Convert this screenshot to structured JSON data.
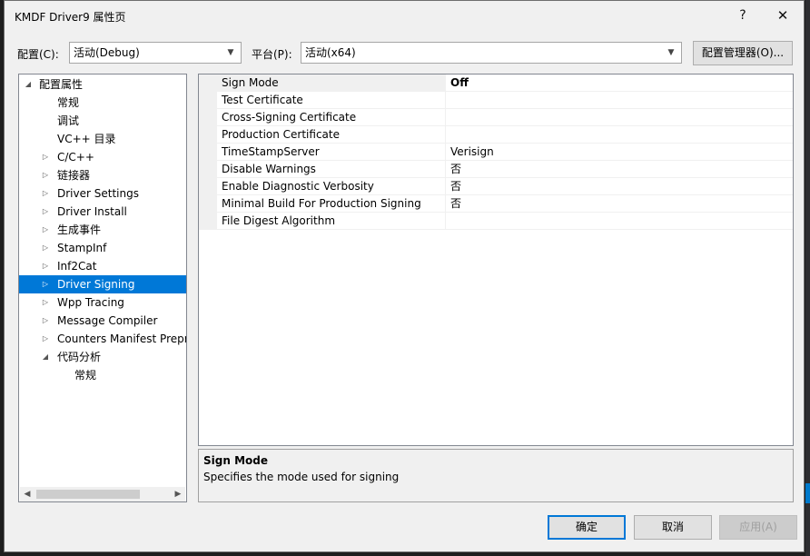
{
  "window": {
    "title": "KMDF Driver9 属性页",
    "help_glyph": "?",
    "close_glyph": "✕"
  },
  "toolbar": {
    "config_label": "配置(C):",
    "config_value": "活动(Debug)",
    "platform_label": "平台(P):",
    "platform_value": "活动(x64)",
    "config_manager_label": "配置管理器(O)..."
  },
  "tree": {
    "items": [
      {
        "label": "配置属性",
        "toggle": "◢",
        "level": 0
      },
      {
        "label": "常规",
        "toggle": "",
        "level": 1
      },
      {
        "label": "调试",
        "toggle": "",
        "level": 1
      },
      {
        "label": "VC++ 目录",
        "toggle": "",
        "level": 1
      },
      {
        "label": "C/C++",
        "toggle": "▷",
        "level": 1
      },
      {
        "label": "链接器",
        "toggle": "▷",
        "level": 1
      },
      {
        "label": "Driver Settings",
        "toggle": "▷",
        "level": 1
      },
      {
        "label": "Driver Install",
        "toggle": "▷",
        "level": 1
      },
      {
        "label": "生成事件",
        "toggle": "▷",
        "level": 1
      },
      {
        "label": "StampInf",
        "toggle": "▷",
        "level": 1
      },
      {
        "label": "Inf2Cat",
        "toggle": "▷",
        "level": 1
      },
      {
        "label": "Driver Signing",
        "toggle": "▷",
        "level": 1,
        "selected": true
      },
      {
        "label": "Wpp Tracing",
        "toggle": "▷",
        "level": 1
      },
      {
        "label": "Message Compiler",
        "toggle": "▷",
        "level": 1
      },
      {
        "label": "Counters Manifest Prepr",
        "toggle": "▷",
        "level": 1
      },
      {
        "label": "代码分析",
        "toggle": "◢",
        "level": 1
      },
      {
        "label": "常规",
        "toggle": "",
        "level": 2
      }
    ]
  },
  "grid": {
    "rows": [
      {
        "name": "Sign Mode",
        "value": "Off",
        "bold": true,
        "selected": true
      },
      {
        "name": "Test Certificate",
        "value": ""
      },
      {
        "name": "Cross-Signing Certificate",
        "value": ""
      },
      {
        "name": "Production Certificate",
        "value": ""
      },
      {
        "name": "TimeStampServer",
        "value": "Verisign"
      },
      {
        "name": "Disable Warnings",
        "value": "否"
      },
      {
        "name": "Enable Diagnostic Verbosity",
        "value": "否"
      },
      {
        "name": "Minimal Build For Production Signing",
        "value": "否"
      },
      {
        "name": "File Digest Algorithm",
        "value": ""
      }
    ]
  },
  "description": {
    "title": "Sign Mode",
    "text": "Specifies the mode used for signing"
  },
  "buttons": {
    "ok": "确定",
    "cancel": "取消",
    "apply": "应用(A)"
  },
  "colors": {
    "selection": "#0078d7",
    "accent_border": "#0078d7"
  }
}
